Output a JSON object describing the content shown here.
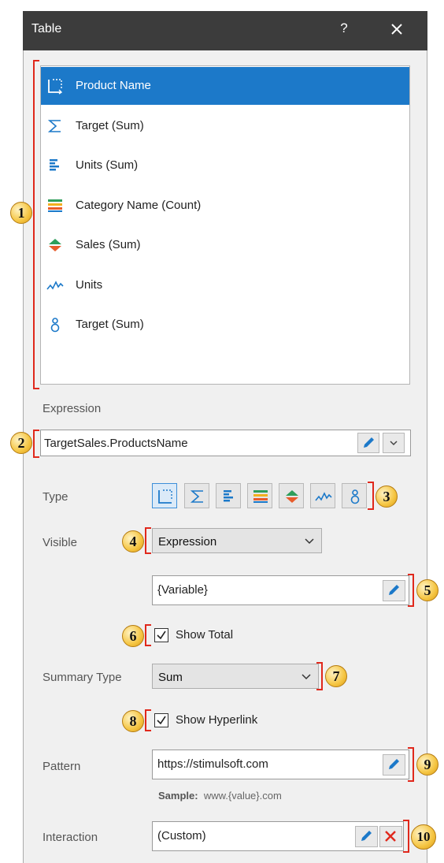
{
  "window": {
    "title": "Table",
    "help": "?"
  },
  "list": {
    "items": [
      {
        "label": "Product Name",
        "icon": "dimension-icon",
        "selected": true
      },
      {
        "label": "Target (Sum)",
        "icon": "sum-icon"
      },
      {
        "label": "Units (Sum)",
        "icon": "bars-icon"
      },
      {
        "label": "Category Name (Count)",
        "icon": "color-bars-icon"
      },
      {
        "label": "Sales (Sum)",
        "icon": "up-down-arrows-icon"
      },
      {
        "label": "Units",
        "icon": "sparkline-icon"
      },
      {
        "label": "Target (Sum)",
        "icon": "bullet-icon"
      }
    ]
  },
  "expression": {
    "label": "Expression",
    "value": "TargetSales.ProductsName"
  },
  "type": {
    "label": "Type"
  },
  "visible": {
    "label": "Visible",
    "selected": "Expression",
    "variable": "{Variable}"
  },
  "show_total": {
    "label": "Show Total",
    "checked": true
  },
  "summary_type": {
    "label": "Summary Type",
    "selected": "Sum"
  },
  "show_hyperlink": {
    "label": "Show Hyperlink",
    "checked": true
  },
  "pattern": {
    "label": "Pattern",
    "value": "https://stimulsoft.com",
    "sample_label": "Sample:",
    "sample_value": "www.{value}.com"
  },
  "interaction": {
    "label": "Interaction",
    "value": "(Custom)"
  },
  "badges": [
    "1",
    "2",
    "3",
    "4",
    "5",
    "6",
    "7",
    "8",
    "9",
    "10"
  ],
  "colors": {
    "titlebar": "#3c3c3c",
    "selection": "#1c79c9",
    "annotation_red": "#e0281c",
    "badge_gold": "#f5c542"
  }
}
